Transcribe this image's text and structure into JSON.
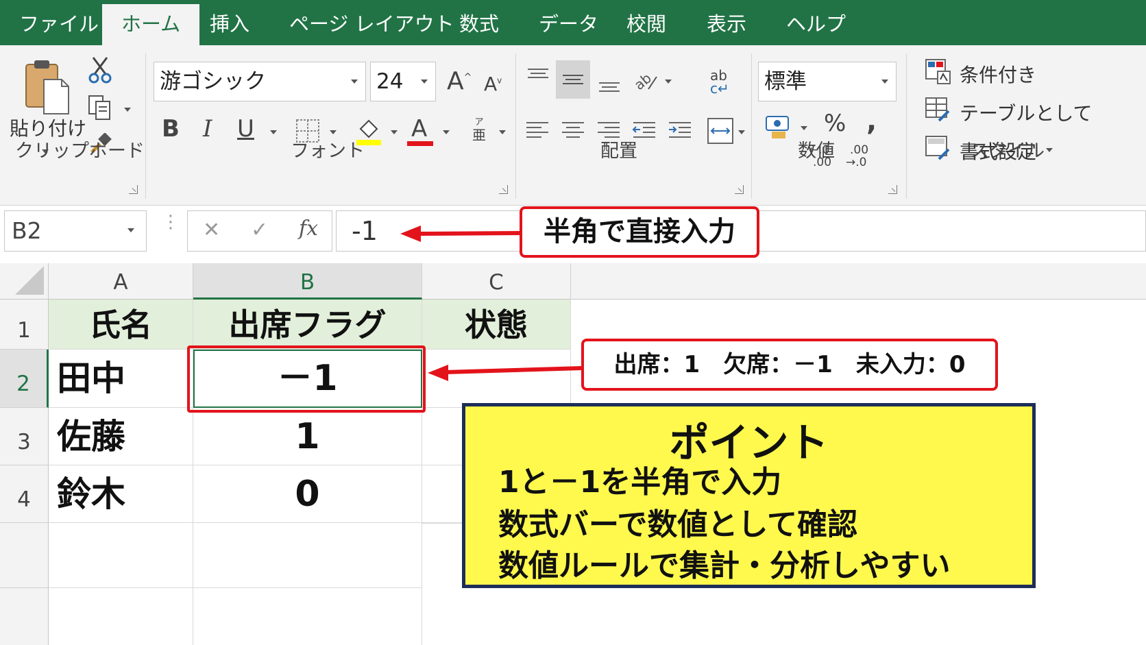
{
  "tabs": [
    "ファイル",
    "ホーム",
    "挿入",
    "ページ レイアウト",
    "数式",
    "データ",
    "校閲",
    "表示",
    "ヘルプ"
  ],
  "active_tab": "ホーム",
  "ribbon": {
    "clipboard": {
      "paste_label": "貼り付け",
      "group_label": "クリップボード"
    },
    "font": {
      "font_name": "游ゴシック",
      "font_size": "24",
      "group_label": "フォント",
      "bold": "B",
      "italic": "I",
      "underline": "U",
      "grow": "A",
      "shrink": "A",
      "font_color_glyph": "A",
      "phonetic_top": "ア",
      "phonetic_bottom": "亜"
    },
    "alignment": {
      "group_label": "配置",
      "wrap_top": "ab",
      "wrap_bottom": "c"
    },
    "number": {
      "format": "標準",
      "group_label": "数値",
      "percent": "%",
      "comma": ",",
      "inc_decimal": [
        "←.0",
        ".00"
      ],
      "dec_decimal": [
        ".00",
        "→.0"
      ]
    },
    "styles": {
      "conditional": "条件付き",
      "table": "テーブルとして",
      "cell_styles": "書式設定",
      "group_label": "スタイル"
    }
  },
  "formula_bar": {
    "name_box": "B2",
    "fx": "fx",
    "cancel": "✕",
    "enter": "✓",
    "value": "-1"
  },
  "sheet": {
    "columns": [
      "A",
      "B",
      "C"
    ],
    "selected_column": "B",
    "rows": [
      "1",
      "2",
      "3",
      "4"
    ],
    "selected_row": "2",
    "headers": [
      "氏名",
      "出席フラグ",
      "状態"
    ],
    "data": [
      {
        "name": "田中",
        "flag": "－1"
      },
      {
        "name": "佐藤",
        "flag": "1"
      },
      {
        "name": "鈴木",
        "flag": "0"
      }
    ]
  },
  "annotations": {
    "formula_callout": "半角で直接入力",
    "legend_callout": "出席：1　欠席：－1　未入力：0",
    "point": {
      "title": "ポイント",
      "lines": [
        "1と－1を半角で入力",
        "数式バーで数値として確認",
        "数値ルールで集計・分析しやすい"
      ]
    }
  },
  "colors": {
    "excel_green": "#217346",
    "callout_red": "#e3131b",
    "point_yellow": "#fff94d",
    "point_border": "#1c2e58",
    "header_fill": "#e2efda"
  }
}
